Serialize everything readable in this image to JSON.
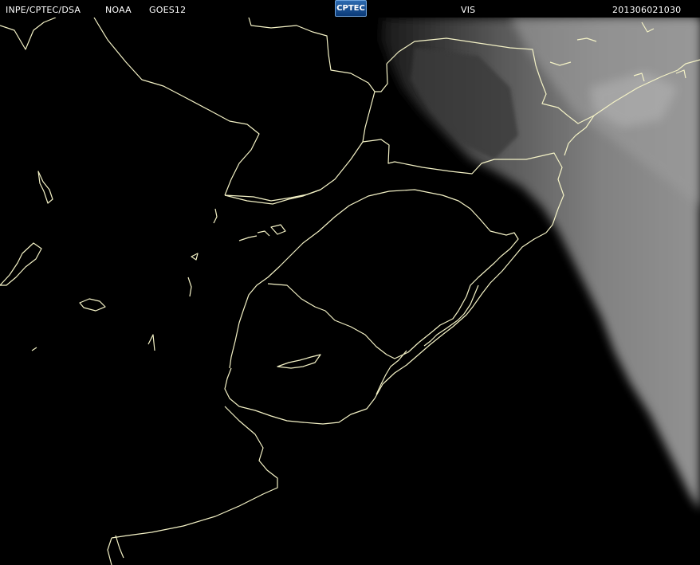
{
  "header": {
    "institution": "INPE/CPTEC/DSA",
    "agency": "NOAA",
    "satellite": "GOES12",
    "logo_text": "CPTEC",
    "channel": "VIS",
    "timestamp": "201306021030"
  },
  "colors": {
    "background": "#000000",
    "coastline": "#f4f2c6",
    "cloud": "#8e8e8e",
    "header_text": "#ffffff"
  }
}
